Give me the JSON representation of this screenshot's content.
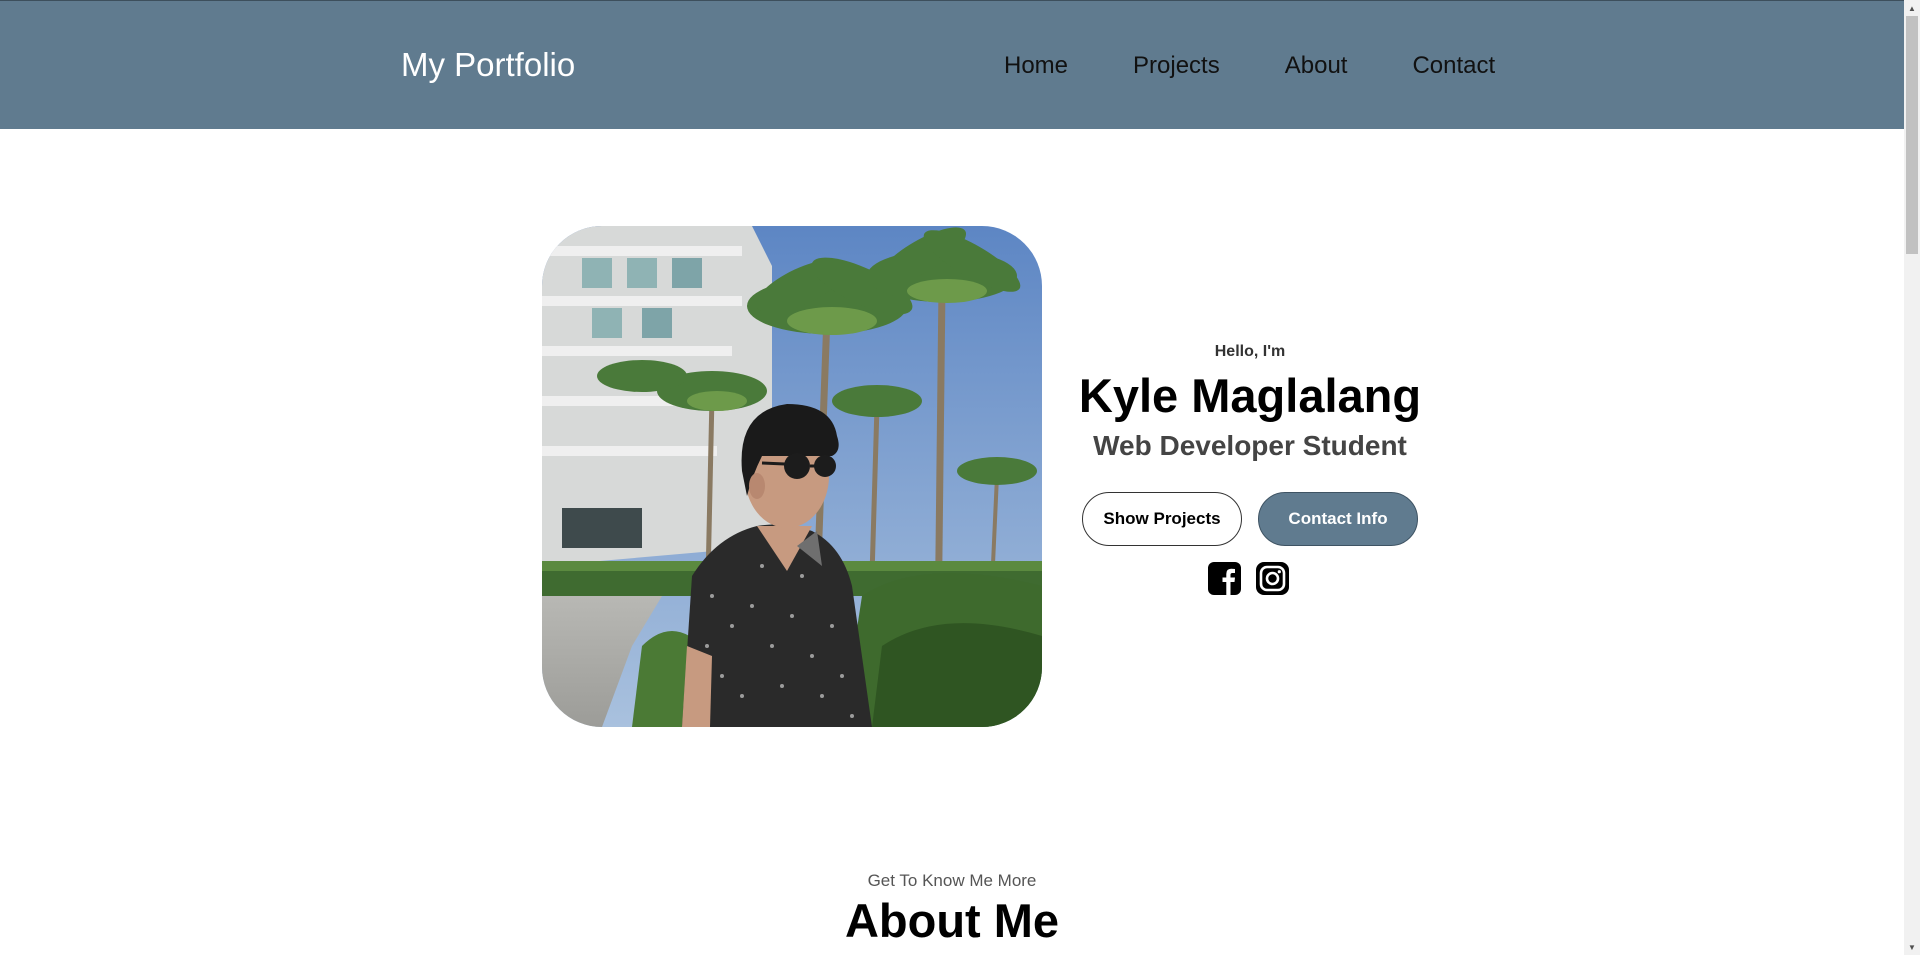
{
  "navbar": {
    "brand": "My Portfolio",
    "links": [
      {
        "label": "Home"
      },
      {
        "label": "Projects"
      },
      {
        "label": "About"
      },
      {
        "label": "Contact"
      }
    ],
    "background": "#607b8f"
  },
  "hero": {
    "greeting": "Hello, I'm",
    "name": "Kyle Maglalang",
    "role": "Web Developer Student",
    "show_projects_label": "Show Projects",
    "contact_info_label": "Contact Info",
    "social_icons": [
      "facebook-icon",
      "instagram-icon"
    ]
  },
  "about": {
    "subtitle": "Get To Know Me More",
    "title": "About Me"
  },
  "colors": {
    "accent": "#607b8f",
    "text": "#000000"
  }
}
